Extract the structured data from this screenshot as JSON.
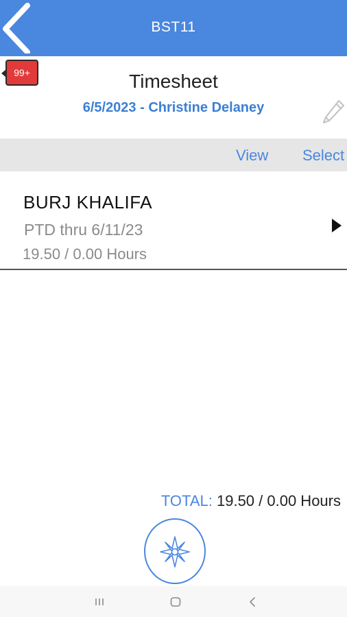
{
  "header": {
    "title": "BST11",
    "back_icon": "chevron-left-icon"
  },
  "notifications": {
    "badge_count": "99+"
  },
  "timesheet": {
    "title": "Timesheet",
    "subtitle": "6/5/2023 - Christine Delaney",
    "edit_icon": "pencil-icon"
  },
  "actions": {
    "view_label": "View",
    "select_label": "Select"
  },
  "jobs": [
    {
      "name": "BURJ KHALIFA",
      "ptd": "PTD thru 6/11/23",
      "hours": "19.50 / 0.00 Hours"
    }
  ],
  "total": {
    "label": "TOTAL:",
    "value": "19.50 / 0.00 Hours"
  },
  "fab": {
    "icon": "compass-icon"
  },
  "system_nav": [
    "recent-apps-icon",
    "home-icon",
    "back-icon"
  ],
  "colors": {
    "accent": "#4a87de",
    "badge": "#e23a3a",
    "subtitle": "#3a7fd5"
  }
}
